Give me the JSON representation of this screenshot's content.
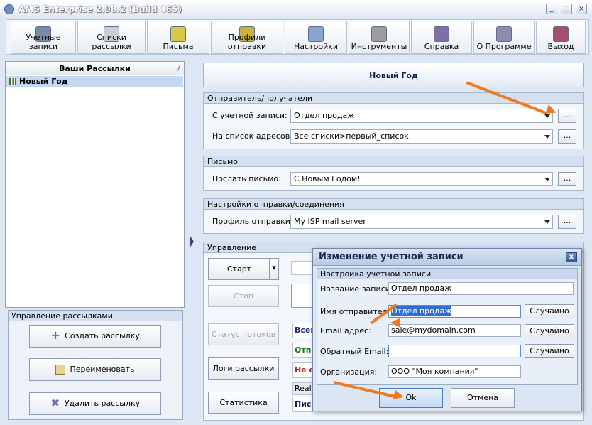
{
  "window": {
    "title": "AMS Enterprise 2.98.2 (Build 465)"
  },
  "toolbar": {
    "items": [
      {
        "label": "Учетные записи",
        "icon": "accounts-icon",
        "color": "#7b8aa3"
      },
      {
        "label": "Списки рассылки",
        "icon": "mailing-lists-icon",
        "color": "#c9cdd6"
      },
      {
        "label": "Письма",
        "icon": "letters-icon",
        "color": "#d6c84a"
      },
      {
        "label": "Профили отправки",
        "icon": "send-profiles-icon",
        "color": "#c6b23c"
      },
      {
        "label": "Настройки",
        "icon": "settings-icon",
        "color": "#8aa4d1"
      },
      {
        "label": "Инструменты",
        "icon": "tools-icon",
        "color": "#9c9c9c"
      },
      {
        "label": "Справка",
        "icon": "help-icon",
        "color": "#7e6fa8"
      },
      {
        "label": "О Программе",
        "icon": "about-icon",
        "color": "#8b8bb0"
      },
      {
        "label": "Выход",
        "icon": "exit-icon",
        "color": "#a44f6c"
      }
    ]
  },
  "campaigns": {
    "header": "Ваши Рассылки",
    "items": [
      "Новый Год"
    ]
  },
  "management": {
    "title": "Управление рассылками",
    "create": "Создать рассылку",
    "rename": "Переименовать",
    "delete": "Удалить рассылку"
  },
  "main": {
    "campaign_title": "Новый Год",
    "sender": {
      "title": "Отправитель/получатели",
      "account_label": "С учетной записи:",
      "account_value": "Отдел продаж",
      "list_label": "На список адресов:",
      "list_value": "Все списки>первый_список",
      "more": "..."
    },
    "letter": {
      "title": "Письмо",
      "label": "Послать письмо:",
      "value": "С Новым Годом!",
      "more": "..."
    },
    "connection": {
      "title": "Настройки отправки/соединения",
      "label": "Профиль отправки:",
      "value": "My ISP mail server",
      "more": "..."
    },
    "control": {
      "title": "Управление",
      "start": "Старт",
      "stop": "Стоп",
      "status": "Статус потоков",
      "logs": "Логи рассылки",
      "stats": "Статистика",
      "stat1": "Всег",
      "stat2": "Отпр",
      "stat3": "Не о",
      "realtime": "Real",
      "sent": "Пис"
    }
  },
  "dialog": {
    "title": "Изменение учетной записи",
    "group": "Настройка учетной записи",
    "name_label": "Название записи:",
    "name_value": "Отдел продаж",
    "sender_label": "Имя отправителя:",
    "sender_value": "Отдел продаж",
    "email_label": "Email адрес:",
    "email_value": "sale@mydomain.com",
    "reply_label": "Обратный Email:",
    "reply_value": "",
    "org_label": "Организация:",
    "org_value": "ООО \"Моя компания\"",
    "random": "Случайно",
    "ok": "Ok",
    "cancel": "Отмена",
    "close": "x"
  },
  "colors": {
    "accent": "#f07a20",
    "selection": "#c5d8f2"
  }
}
